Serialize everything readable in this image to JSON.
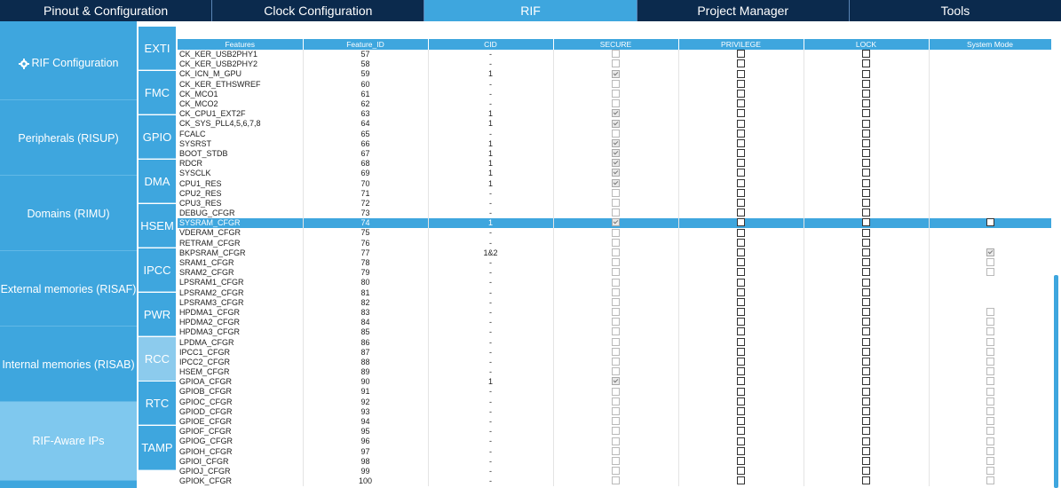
{
  "top_tabs": [
    "Pinout & Configuration",
    "Clock Configuration",
    "RIF",
    "Project Manager",
    "Tools"
  ],
  "active_top_tab": "RIF",
  "left_nav": [
    "RIF Configuration",
    "Peripherals (RISUP)",
    "Domains (RIMU)",
    "External memories (RISAF)",
    "Internal memories (RISAB)",
    "RIF-Aware IPs"
  ],
  "left_nav_selected": "RIF-Aware IPs",
  "mid_nav": [
    "EXTI",
    "FMC",
    "GPIO",
    "DMA",
    "HSEM",
    "IPCC",
    "PWR",
    "RCC",
    "RTC",
    "TAMP"
  ],
  "mid_nav_selected": "RCC",
  "table": {
    "headers": [
      "Features",
      "Feature_ID",
      "CID",
      "SECURE",
      "PRIVILEGE",
      "LOCK",
      "System Mode"
    ],
    "selected_row_index": 17,
    "rows": [
      {
        "feature": "CK_KER_USB2PHY1",
        "id": "57",
        "cid": "-",
        "secure": "dis",
        "privilege": "off",
        "lock": "off",
        "system_mode": "none"
      },
      {
        "feature": "CK_KER_USB2PHY2",
        "id": "58",
        "cid": "-",
        "secure": "dis",
        "privilege": "off",
        "lock": "off",
        "system_mode": "none"
      },
      {
        "feature": "CK_ICN_M_GPU",
        "id": "59",
        "cid": "1",
        "secure": "chk",
        "privilege": "off",
        "lock": "off",
        "system_mode": "none"
      },
      {
        "feature": "CK_KER_ETHSWREF",
        "id": "60",
        "cid": "-",
        "secure": "dis",
        "privilege": "off",
        "lock": "off",
        "system_mode": "none"
      },
      {
        "feature": "CK_MCO1",
        "id": "61",
        "cid": "-",
        "secure": "dis",
        "privilege": "off",
        "lock": "off",
        "system_mode": "none"
      },
      {
        "feature": "CK_MCO2",
        "id": "62",
        "cid": "-",
        "secure": "dis",
        "privilege": "off",
        "lock": "off",
        "system_mode": "none"
      },
      {
        "feature": "CK_CPU1_EXT2F",
        "id": "63",
        "cid": "1",
        "secure": "chk",
        "privilege": "off",
        "lock": "off",
        "system_mode": "none"
      },
      {
        "feature": "CK_SYS_PLL4,5,6,7,8",
        "id": "64",
        "cid": "1",
        "secure": "chk",
        "privilege": "off",
        "lock": "off",
        "system_mode": "none"
      },
      {
        "feature": "FCALC",
        "id": "65",
        "cid": "-",
        "secure": "dis",
        "privilege": "off",
        "lock": "off",
        "system_mode": "none"
      },
      {
        "feature": "SYSRST",
        "id": "66",
        "cid": "1",
        "secure": "chk",
        "privilege": "off",
        "lock": "off",
        "system_mode": "none"
      },
      {
        "feature": "BOOT_STDB",
        "id": "67",
        "cid": "1",
        "secure": "chk",
        "privilege": "off",
        "lock": "off",
        "system_mode": "none"
      },
      {
        "feature": "RDCR",
        "id": "68",
        "cid": "1",
        "secure": "chk",
        "privilege": "off",
        "lock": "off",
        "system_mode": "none"
      },
      {
        "feature": "SYSCLK",
        "id": "69",
        "cid": "1",
        "secure": "chk",
        "privilege": "off",
        "lock": "off",
        "system_mode": "none"
      },
      {
        "feature": "CPU1_RES",
        "id": "70",
        "cid": "1",
        "secure": "chk",
        "privilege": "off",
        "lock": "off",
        "system_mode": "none"
      },
      {
        "feature": "CPU2_RES",
        "id": "71",
        "cid": "-",
        "secure": "dis",
        "privilege": "off",
        "lock": "off",
        "system_mode": "none"
      },
      {
        "feature": "CPU3_RES",
        "id": "72",
        "cid": "-",
        "secure": "dis",
        "privilege": "off",
        "lock": "off",
        "system_mode": "none"
      },
      {
        "feature": "DEBUG_CFGR",
        "id": "73",
        "cid": "-",
        "secure": "dis",
        "privilege": "off",
        "lock": "off",
        "system_mode": "none"
      },
      {
        "feature": "SYSRAM_CFGR",
        "id": "74",
        "cid": "1",
        "secure": "chk",
        "privilege": "off",
        "lock": "off",
        "system_mode": "off"
      },
      {
        "feature": "VDERAM_CFGR",
        "id": "75",
        "cid": "-",
        "secure": "dis",
        "privilege": "off",
        "lock": "off",
        "system_mode": "none"
      },
      {
        "feature": "RETRAM_CFGR",
        "id": "76",
        "cid": "-",
        "secure": "dis",
        "privilege": "off",
        "lock": "off",
        "system_mode": "none"
      },
      {
        "feature": "BKPSRAM_CFGR",
        "id": "77",
        "cid": "1&2",
        "secure": "dis",
        "privilege": "off",
        "lock": "off",
        "system_mode": "chk"
      },
      {
        "feature": "SRAM1_CFGR",
        "id": "78",
        "cid": "-",
        "secure": "dis",
        "privilege": "off",
        "lock": "off",
        "system_mode": "dis"
      },
      {
        "feature": "SRAM2_CFGR",
        "id": "79",
        "cid": "-",
        "secure": "dis",
        "privilege": "off",
        "lock": "off",
        "system_mode": "dis"
      },
      {
        "feature": "LPSRAM1_CFGR",
        "id": "80",
        "cid": "-",
        "secure": "dis",
        "privilege": "off",
        "lock": "off",
        "system_mode": "none"
      },
      {
        "feature": "LPSRAM2_CFGR",
        "id": "81",
        "cid": "-",
        "secure": "dis",
        "privilege": "off",
        "lock": "off",
        "system_mode": "none"
      },
      {
        "feature": "LPSRAM3_CFGR",
        "id": "82",
        "cid": "-",
        "secure": "dis",
        "privilege": "off",
        "lock": "off",
        "system_mode": "none"
      },
      {
        "feature": "HPDMA1_CFGR",
        "id": "83",
        "cid": "-",
        "secure": "dis",
        "privilege": "off",
        "lock": "off",
        "system_mode": "dis"
      },
      {
        "feature": "HPDMA2_CFGR",
        "id": "84",
        "cid": "-",
        "secure": "dis",
        "privilege": "off",
        "lock": "off",
        "system_mode": "dis"
      },
      {
        "feature": "HPDMA3_CFGR",
        "id": "85",
        "cid": "-",
        "secure": "dis",
        "privilege": "off",
        "lock": "off",
        "system_mode": "dis"
      },
      {
        "feature": "LPDMA_CFGR",
        "id": "86",
        "cid": "-",
        "secure": "dis",
        "privilege": "off",
        "lock": "off",
        "system_mode": "dis"
      },
      {
        "feature": "IPCC1_CFGR",
        "id": "87",
        "cid": "-",
        "secure": "dis",
        "privilege": "off",
        "lock": "off",
        "system_mode": "dis"
      },
      {
        "feature": "IPCC2_CFGR",
        "id": "88",
        "cid": "-",
        "secure": "dis",
        "privilege": "off",
        "lock": "off",
        "system_mode": "dis"
      },
      {
        "feature": "HSEM_CFGR",
        "id": "89",
        "cid": "-",
        "secure": "dis",
        "privilege": "off",
        "lock": "off",
        "system_mode": "dis"
      },
      {
        "feature": "GPIOA_CFGR",
        "id": "90",
        "cid": "1",
        "secure": "chk",
        "privilege": "off",
        "lock": "off",
        "system_mode": "dis"
      },
      {
        "feature": "GPIOB_CFGR",
        "id": "91",
        "cid": "-",
        "secure": "dis",
        "privilege": "off",
        "lock": "off",
        "system_mode": "dis"
      },
      {
        "feature": "GPIOC_CFGR",
        "id": "92",
        "cid": "-",
        "secure": "dis",
        "privilege": "off",
        "lock": "off",
        "system_mode": "dis"
      },
      {
        "feature": "GPIOD_CFGR",
        "id": "93",
        "cid": "-",
        "secure": "dis",
        "privilege": "off",
        "lock": "off",
        "system_mode": "dis"
      },
      {
        "feature": "GPIOE_CFGR",
        "id": "94",
        "cid": "-",
        "secure": "dis",
        "privilege": "off",
        "lock": "off",
        "system_mode": "dis"
      },
      {
        "feature": "GPIOF_CFGR",
        "id": "95",
        "cid": "-",
        "secure": "dis",
        "privilege": "off",
        "lock": "off",
        "system_mode": "dis"
      },
      {
        "feature": "GPIOG_CFGR",
        "id": "96",
        "cid": "-",
        "secure": "dis",
        "privilege": "off",
        "lock": "off",
        "system_mode": "dis"
      },
      {
        "feature": "GPIOH_CFGR",
        "id": "97",
        "cid": "-",
        "secure": "dis",
        "privilege": "off",
        "lock": "off",
        "system_mode": "dis"
      },
      {
        "feature": "GPIOI_CFGR",
        "id": "98",
        "cid": "-",
        "secure": "dis",
        "privilege": "off",
        "lock": "off",
        "system_mode": "dis"
      },
      {
        "feature": "GPIOJ_CFGR",
        "id": "99",
        "cid": "-",
        "secure": "dis",
        "privilege": "off",
        "lock": "off",
        "system_mode": "dis"
      },
      {
        "feature": "GPIOK_CFGR",
        "id": "100",
        "cid": "-",
        "secure": "dis",
        "privilege": "off",
        "lock": "off",
        "system_mode": "dis"
      }
    ]
  },
  "colors": {
    "accent": "#3ea6de",
    "topbar": "#0b2a4d",
    "selected_nav": "#7fc8ee"
  },
  "icons": {
    "rif_config": "gear-icon"
  }
}
